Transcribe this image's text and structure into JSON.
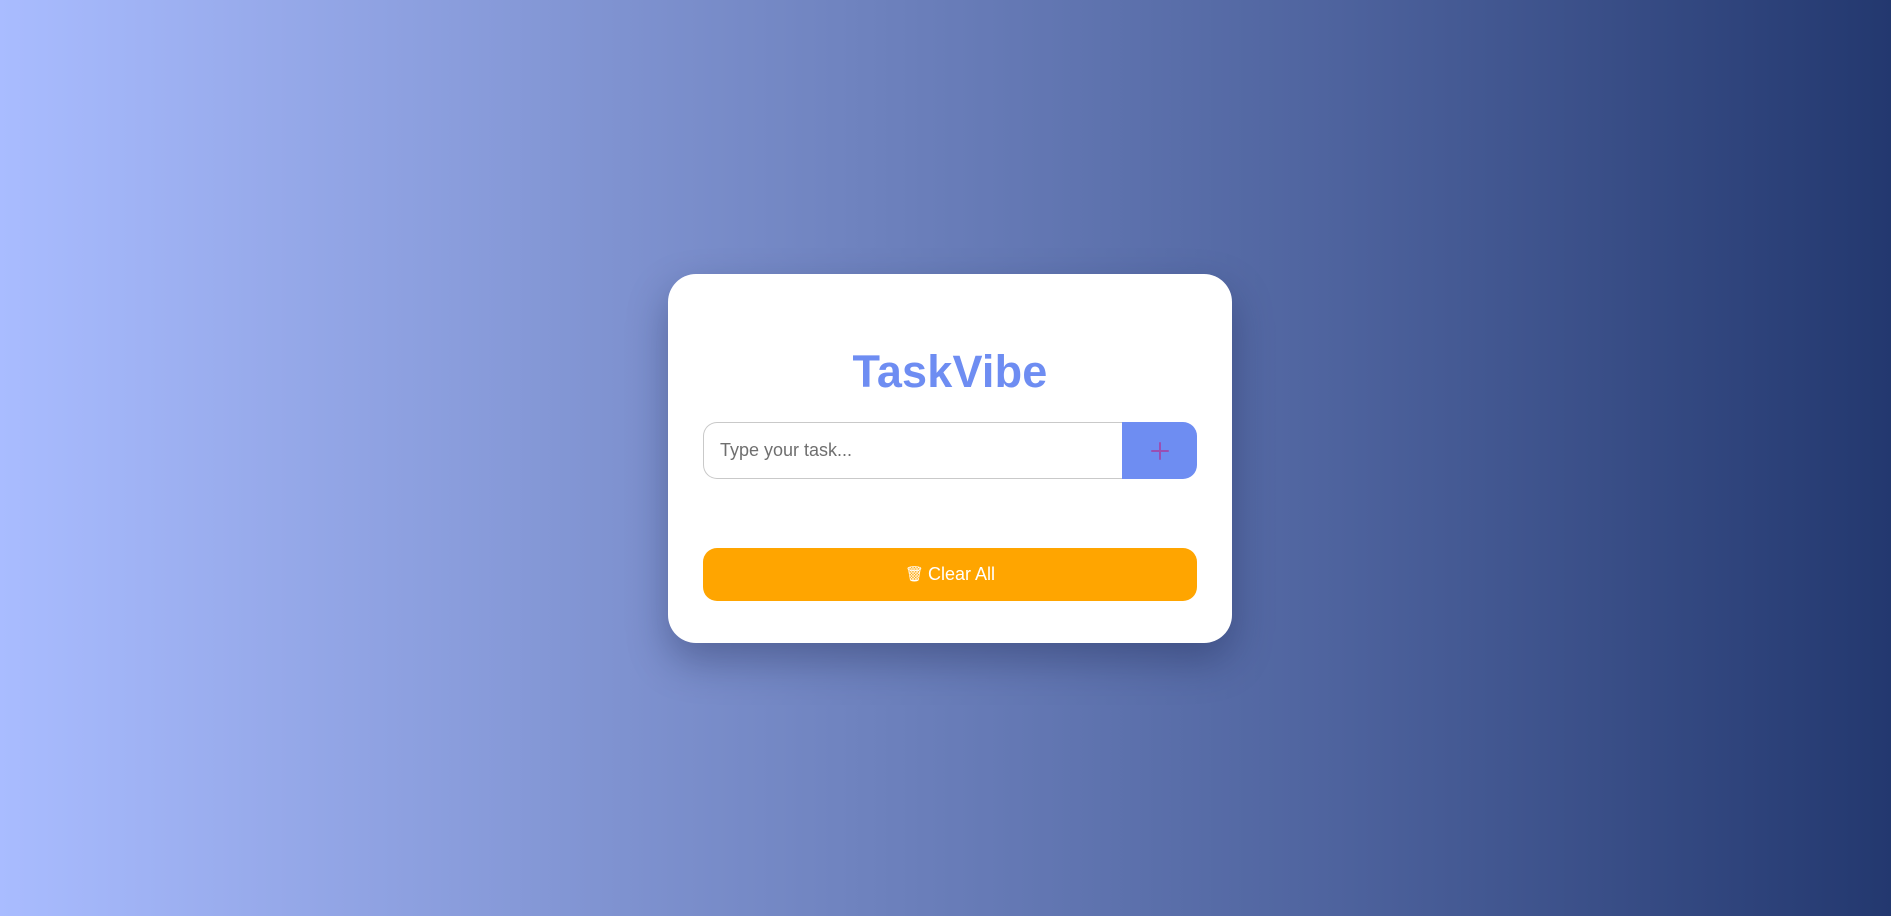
{
  "app": {
    "title": "TaskVibe"
  },
  "task_input": {
    "placeholder": "Type your task...",
    "value": ""
  },
  "add_button": {
    "icon": "plus-icon",
    "icon_glyph": "+"
  },
  "clear_button": {
    "icon": "trash-icon",
    "icon_glyph": "🗑",
    "label": "Clear All"
  },
  "colors": {
    "accent": "#6e8df2",
    "clear_button": "#ffa500",
    "plus_icon": "#9b4fb3",
    "background_start": "#a9bcff",
    "background_end": "#23386f"
  }
}
